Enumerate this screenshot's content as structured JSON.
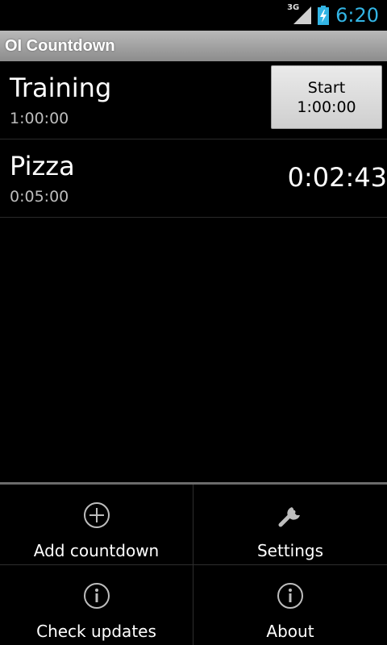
{
  "status_bar": {
    "network": "3G",
    "time": "6:20",
    "clock_color": "#33b5e5"
  },
  "app_title": "OI Countdown",
  "countdowns": [
    {
      "name": "Training",
      "duration": "1:00:00",
      "action": {
        "line1": "Start",
        "line2": "1:00:00"
      }
    },
    {
      "name": "Pizza",
      "duration": "0:05:00",
      "remaining": "0:02:43"
    }
  ],
  "menu": {
    "items": [
      {
        "label": "Add countdown",
        "icon": "add-circle-icon"
      },
      {
        "label": "Settings",
        "icon": "wrench-icon"
      },
      {
        "label": "Check updates",
        "icon": "info-icon"
      },
      {
        "label": "About",
        "icon": "info-icon"
      }
    ]
  }
}
